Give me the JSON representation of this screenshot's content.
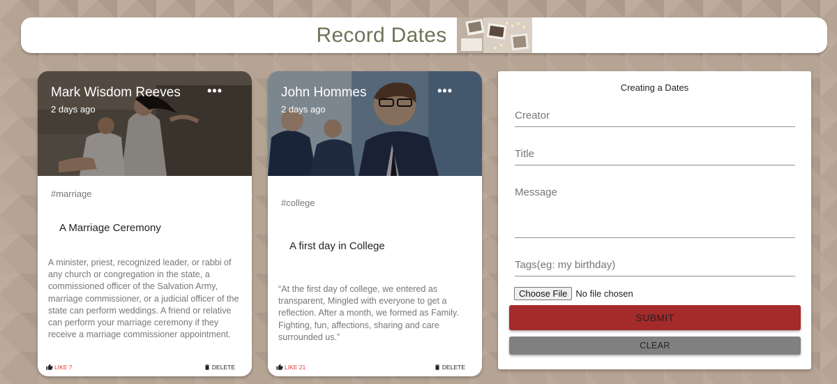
{
  "app": {
    "title": "Record Dates",
    "logo_icon": "photo-collage-icon"
  },
  "posts": [
    {
      "creator": "Mark Wisdom Reeves",
      "time": "2 days ago",
      "tags": "#marriage",
      "title": "A Marriage Ceremony",
      "message": "A minister, priest, recognized leader, or rabbi of any church or congregation in the state, a commissioned officer of the Salvation Army, marriage commissioner, or a judicial officer of the state can perform weddings. A friend or relative can perform your marriage ceremony if they receive a marriage commissioner appointment.",
      "like_label": "LIKE 7",
      "delete_label": "DELETE",
      "image_icon": "wedding-photo"
    },
    {
      "creator": "John Hommes",
      "time": "2 days ago",
      "tags": "#college",
      "title": "A first day in College",
      "message": "“At the first day of college, we entered as transparent, Mingled with everyone to get a reflection. After a month, we formed as Family. Fighting, fun, affections, sharing and care surrounded us.”",
      "like_label": "LIKE 21",
      "delete_label": "DELETE",
      "image_icon": "college-students-photo"
    }
  ],
  "form": {
    "title": "Creating a Dates",
    "creator_placeholder": "Creator",
    "creator_value": "",
    "title_placeholder": "Title",
    "title_value": "",
    "message_placeholder": "Message",
    "message_value": "",
    "tags_placeholder": "Tags(eg: my birthday)",
    "tags_value": "",
    "file_button": "Choose File",
    "file_status": "No file chosen",
    "submit_label": "SUBMIT",
    "clear_label": "CLEAR"
  },
  "colors": {
    "background": "#b5a393",
    "title_text": "#6e7357",
    "submit": "#a52a2a",
    "clear": "#808080",
    "like": "#e53935"
  }
}
